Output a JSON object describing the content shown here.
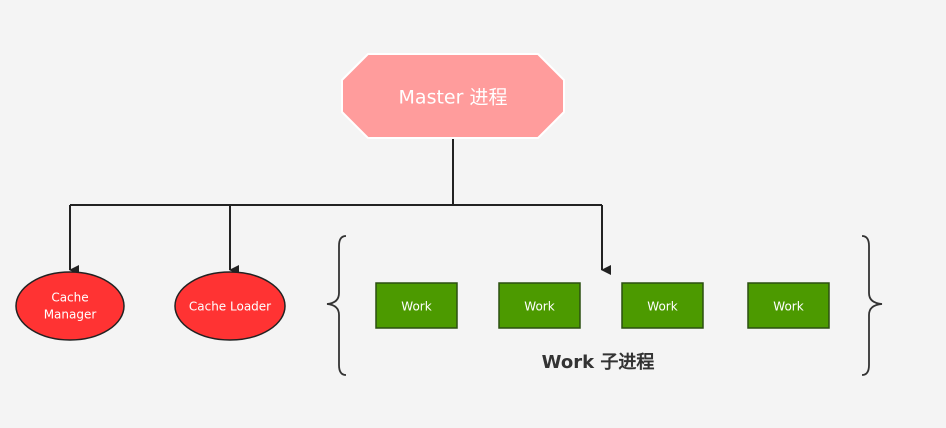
{
  "master": {
    "label": "Master 进程",
    "fill": "#ff9c9c"
  },
  "cache_manager": {
    "line1": "Cache",
    "line2": "Manager",
    "fill": "#ff3333"
  },
  "cache_loader": {
    "label": "Cache Loader",
    "fill": "#ff3333"
  },
  "workers": [
    {
      "label": "Work"
    },
    {
      "label": "Work"
    },
    {
      "label": "Work"
    },
    {
      "label": "Work"
    }
  ],
  "worker_fill": "#4c9a00",
  "worker_group_label": "Work 子进程",
  "line_color": "#222222"
}
